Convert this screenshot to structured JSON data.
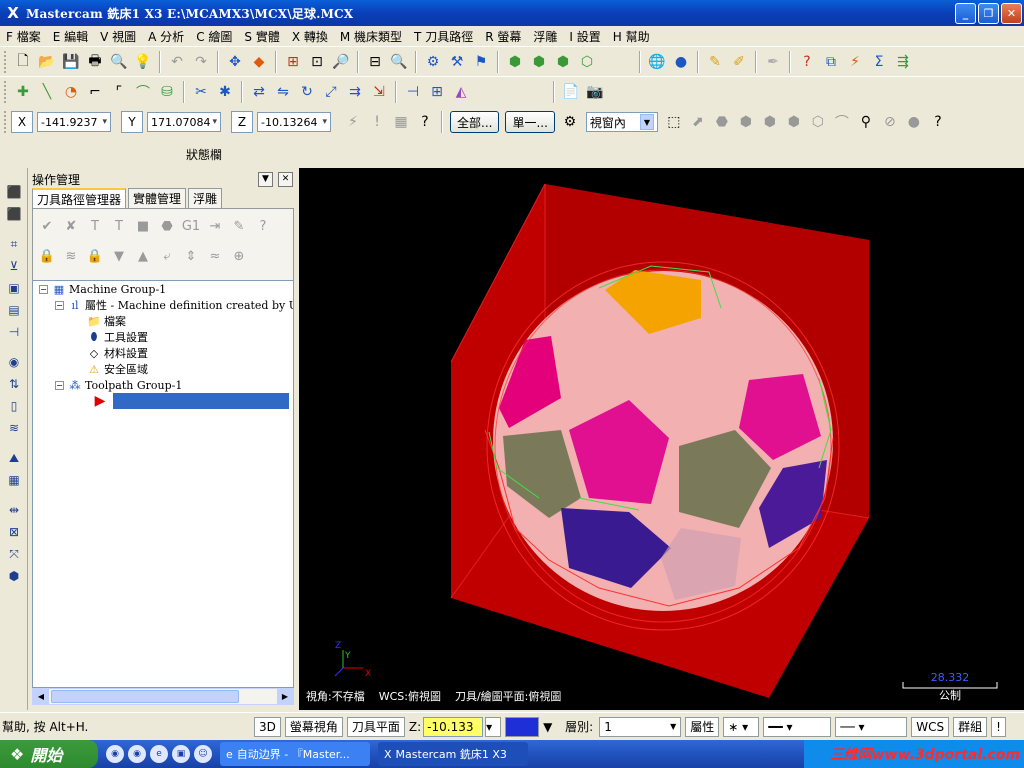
{
  "window": {
    "title": "Mastercam 銑床1 X3   E:\\MCAMX3\\MCX\\足球.MCX",
    "app_icon": "X"
  },
  "menu": [
    "F 檔案",
    "E 編輯",
    "V 視圖",
    "A 分析",
    "C 繪圖",
    "S 實體",
    "X 轉換",
    "M 機床類型",
    "T 刀具路徑",
    "R 螢幕",
    "浮雕",
    "I 設置",
    "H 幫助"
  ],
  "coords": {
    "x_label": "X",
    "x_value": "-141.9237",
    "y_label": "Y",
    "y_value": "171.07084",
    "z_label": "Z",
    "z_value": "-10.13264"
  },
  "toolbar3": {
    "all_button": "全部...",
    "single_button": "單一...",
    "view_select": "視窗內"
  },
  "status_label": "狀態欄",
  "ops": {
    "header": "操作管理",
    "tabs": [
      "刀具路徑管理器",
      "實體管理",
      "浮雕"
    ],
    "tree": {
      "machine_group": "Machine Group-1",
      "properties": "屬性 - Machine definition created by Upg",
      "files": "檔案",
      "tool_settings": "工具設置",
      "material_settings": "材料設置",
      "safety_zone": "安全區域",
      "toolpath_group": "Toolpath Group-1"
    }
  },
  "viewport": {
    "info": [
      "視角:不存檔",
      "WCS:俯視圖",
      "刀具/繪圖平面:俯視圖"
    ],
    "scale_value": "28.332",
    "scale_unit": "公制",
    "axis_x": "X",
    "axis_y": "Y",
    "axis_z": "Z"
  },
  "bottombar": {
    "help": "幫助, 按 Alt+H.",
    "btn_3d": "3D",
    "btn_screen_view": "螢幕視角",
    "btn_tool_plane": "刀具平面",
    "z_label": "Z:",
    "z_value": "-10.133",
    "level_label": "層別:",
    "level_value": "1",
    "attributes": "屬性",
    "wcs": "WCS",
    "group": "群組"
  },
  "taskbar": {
    "start": "開始",
    "task1": "自动边界 - 『Master...",
    "task2": "Mastercam 銑床1 X3",
    "watermark": "三维网www.3dportal.com"
  }
}
